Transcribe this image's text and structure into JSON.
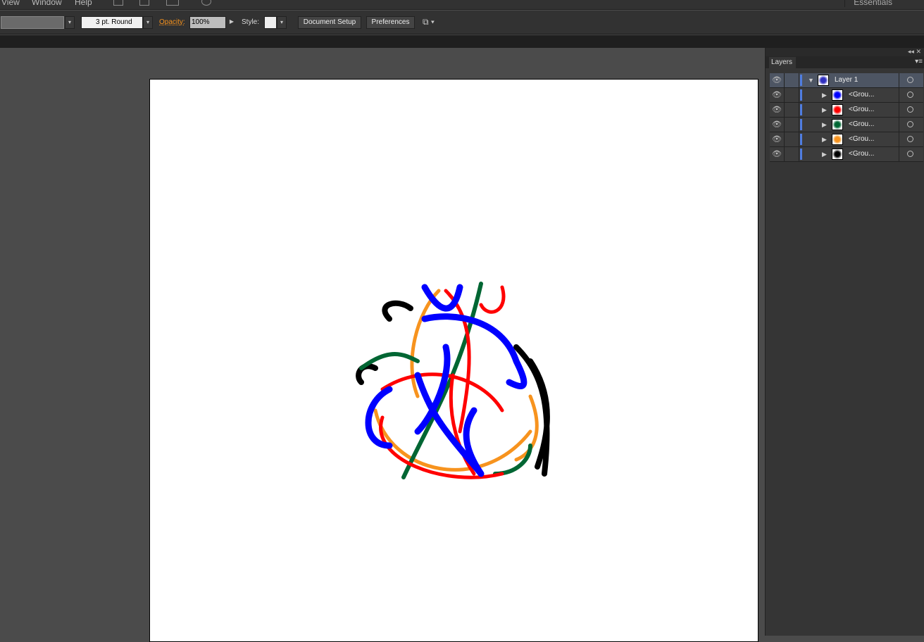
{
  "menubar": {
    "items": [
      "View",
      "Window",
      "Help"
    ],
    "workspace": "Essentials"
  },
  "control": {
    "stroke_weight": "3 pt. Round",
    "opacity_label": "Opacity:",
    "opacity_value": "100%",
    "style_label": "Style:",
    "document_setup": "Document Setup",
    "preferences": "Preferences"
  },
  "layers_panel": {
    "tab": "Layers",
    "collapse": "◂◂",
    "close": "✕",
    "layers": [
      {
        "name": "Layer 1",
        "expanded": true,
        "thumb_color": "#3030c0"
      },
      {
        "name": "<Grou...",
        "thumb_color": "#0000ff"
      },
      {
        "name": "<Grou...",
        "thumb_color": "#ff0000"
      },
      {
        "name": "<Grou...",
        "thumb_color": "#006633"
      },
      {
        "name": "<Grou...",
        "thumb_color": "#f7931e"
      },
      {
        "name": "<Grou...",
        "thumb_color": "#000000"
      }
    ]
  },
  "colors": {
    "accent": "#f7931e",
    "layer_color": "#4f7de0"
  }
}
